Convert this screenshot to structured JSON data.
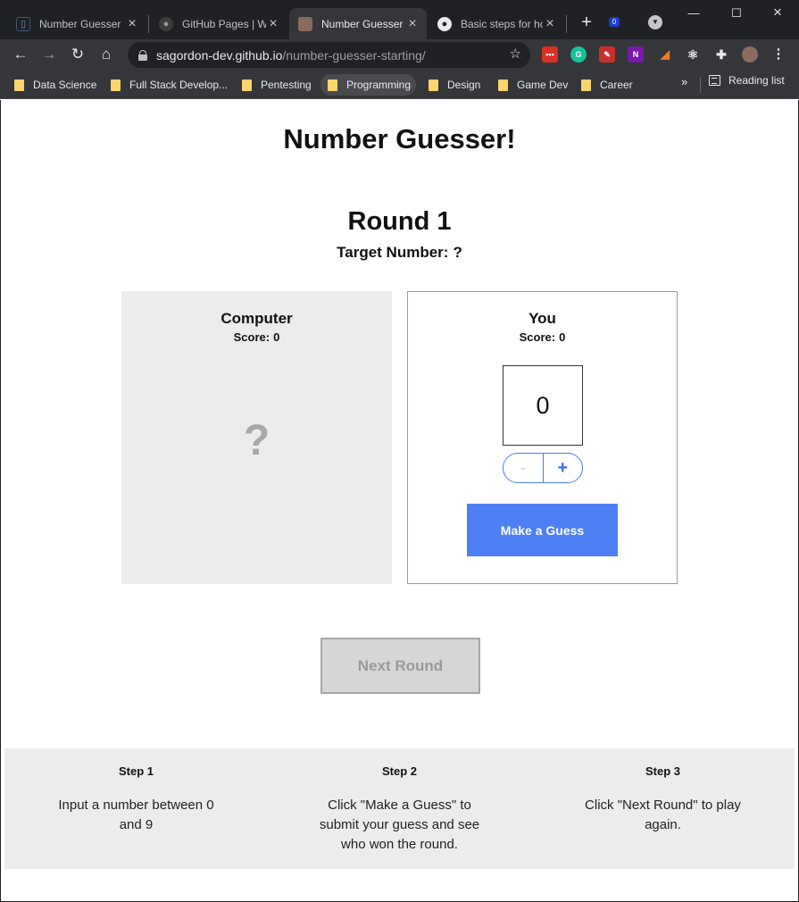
{
  "browser": {
    "tabs": [
      {
        "title": "Number Guesser",
        "active": false
      },
      {
        "title": "GitHub Pages | W",
        "active": false
      },
      {
        "title": "Number Guesser",
        "active": true
      },
      {
        "title": "Basic steps for ho",
        "active": false
      }
    ],
    "url_host": "sagordon-dev.github.io",
    "url_path": "/number-guesser-starting/",
    "extension_badge": "0",
    "bookmarks": [
      "Data Science",
      "Full Stack Develop...",
      "Pentesting",
      "Programming",
      "Design",
      "Game Dev",
      "Career"
    ],
    "bookmarks_more": "»",
    "reading_list": "Reading list"
  },
  "page": {
    "title": "Number Guesser!",
    "round": "Round 1",
    "target_label": "Target Number:",
    "target_value": "?",
    "computer": {
      "name": "Computer",
      "score_label": "Score:",
      "score": "0",
      "guess": "?"
    },
    "you": {
      "name": "You",
      "score_label": "Score:",
      "score": "0",
      "guess_value": "0",
      "minus": "-",
      "plus": "+",
      "guess_button": "Make a Guess"
    },
    "next_round": "Next Round",
    "steps": [
      {
        "title": "Step 1",
        "text": "Input a number between 0 and 9"
      },
      {
        "title": "Step 2",
        "text": "Click \"Make a Guess\" to submit your guess and see who won the round."
      },
      {
        "title": "Step 3",
        "text": "Click \"Next Round\" to play again."
      }
    ]
  },
  "colors": {
    "accent": "#4d80f5",
    "panel_grey": "#ececec",
    "chrome_dark": "#202124",
    "chrome_toolbar": "#35363a"
  }
}
